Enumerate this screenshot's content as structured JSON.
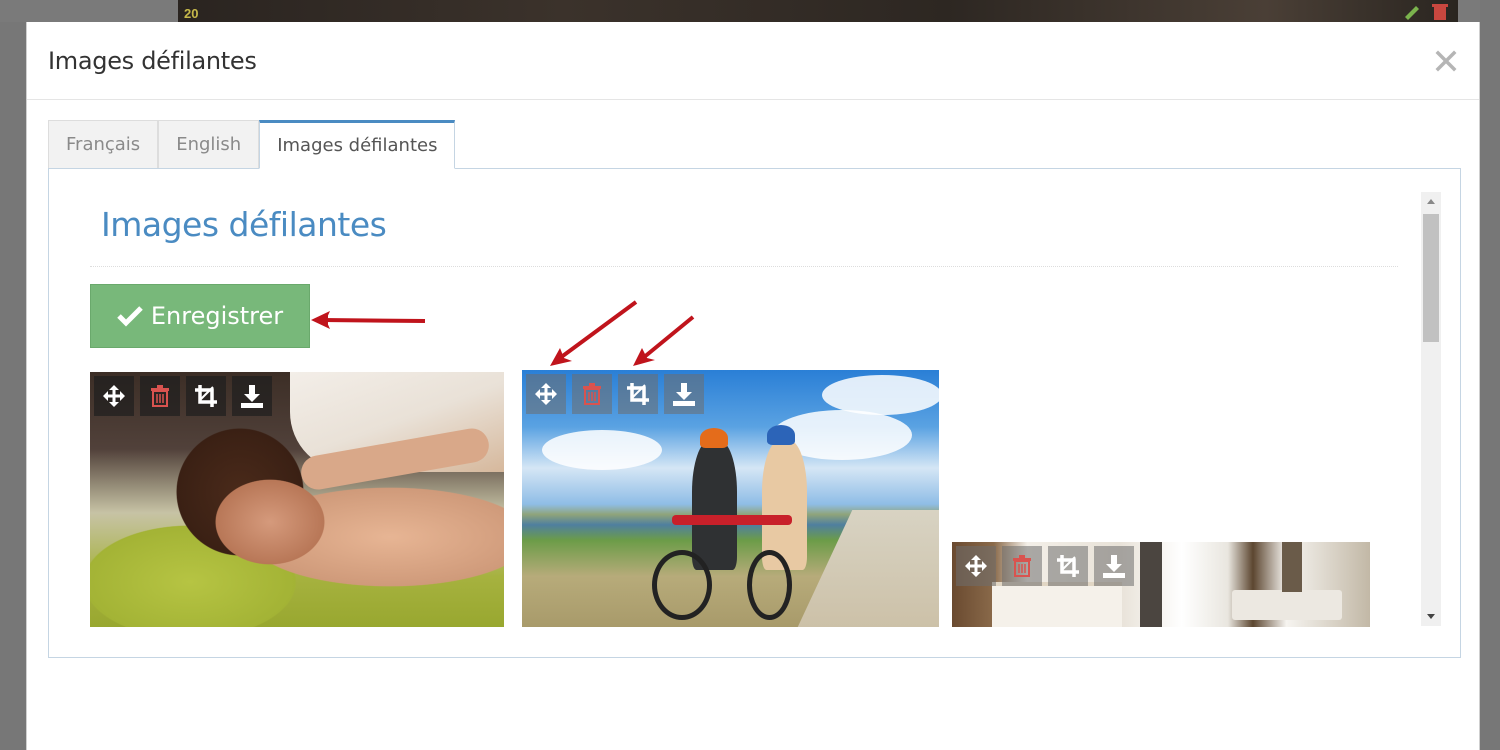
{
  "background": {
    "row_number": "20"
  },
  "modal": {
    "title": "Images défilantes",
    "close_label": "×"
  },
  "tabs": [
    {
      "label": "Français",
      "active": false
    },
    {
      "label": "English",
      "active": false
    },
    {
      "label": "Images défilantes",
      "active": true
    }
  ],
  "section": {
    "title": "Images défilantes",
    "save_label": "Enregistrer"
  },
  "image_tools": [
    "move-icon",
    "trash-icon",
    "crop-icon",
    "download-icon"
  ],
  "images": [
    {
      "subject": "massage"
    },
    {
      "subject": "cyclists"
    },
    {
      "subject": "hotel-room"
    }
  ],
  "colors": {
    "accent": "#4a8bc2",
    "save_button": "#78b87a",
    "trash": "#d9534f",
    "annotation_arrow": "#c0141c"
  }
}
